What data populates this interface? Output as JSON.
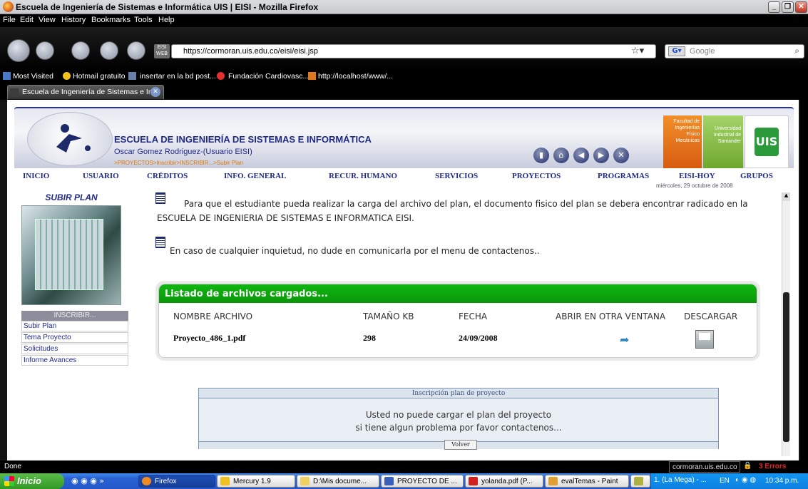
{
  "window": {
    "title": "Escuela de Ingeniería de Sistemas e Informática UIS | EISI - Mozilla Firefox"
  },
  "menubar": [
    "File",
    "Edit",
    "View",
    "History",
    "Bookmarks",
    "Tools",
    "Help"
  ],
  "navbar": {
    "url": "https://cormoran.uis.edu.co/eisi/eisi.jsp",
    "search_placeholder": "Google",
    "site_icon": "EISI WEB"
  },
  "bookmarks": [
    "Most Visited",
    "Hotmail gratuito",
    "insertar en la bd post...",
    "Fundación Cardiovasc...",
    "http://localhost/www/..."
  ],
  "tab": {
    "title": "Escuela de Ingeniería de Sistemas e In..."
  },
  "header": {
    "school": "ESCUELA DE INGENIERÍA DE SISTEMAS E INFORMÁTICA",
    "user": "Oscar Gomez Rodriguez-(Usuario EISI)",
    "breadcrumb": ">PROYECTOS>Inscribir>INSCRIBIR...>Subir Plan",
    "faculty": "Facultad de Ingenierías Físico Mecánicas",
    "university": "Universidad Industrial de Santander",
    "uis": "UIS"
  },
  "mainmenu": [
    "INICIO",
    "USUARIO",
    "CRÉDITOS",
    "INFO. GENERAL",
    "RECUR. HUMANO",
    "SERVICIOS",
    "PROYECTOS",
    "PROGRAMAS",
    "EISI-HOY",
    "GRUPOS"
  ],
  "date": "miércoles, 29 octubre de 2008",
  "sidebar": {
    "title": "SUBIR PLAN",
    "section": "INSCRIBIR...",
    "links": [
      "Subir Plan",
      "Tema Proyecto",
      "Solicitudes",
      "Informe Avances"
    ]
  },
  "content": {
    "para1": "Para que el estudiante pueda realizar la carga del archivo del plan, el documento fisico del plan se debera encontrar radicado en la ESCUELA DE INGENIERIA DE SISTEMAS E       INFORMATICA EISI.",
    "para2": "En caso de cualquier inquietud, no dude en comunicarla por el menu de contactenos..",
    "files": {
      "title": "Listado de archivos cargados...",
      "headers": [
        "NOMBRE ARCHIVO",
        "TAMAÑO KB",
        "FECHA",
        "ABRIR EN OTRA VENTANA",
        "DESCARGAR"
      ],
      "rows": [
        {
          "name": "Proyecto_486_1.pdf",
          "size": "298",
          "date": "24/09/2008"
        }
      ]
    },
    "inscripcion": {
      "title": "Inscripción plan de proyecto",
      "msg1": "Usted no puede cargar el plan del proyecto",
      "msg2": "si tiene algun problema por favor contactenos...",
      "button": "Volver"
    }
  },
  "status": {
    "left": "Done",
    "domain": "cormoran.uis.edu.co",
    "errors": "3 Errors"
  },
  "taskbar": {
    "start": "Inicio",
    "items": [
      "Firefox",
      "Mercury 1.9",
      "D:\\Mis docume...",
      "PROYECTO DE ...",
      "yolanda.pdf (P...",
      "evalTemas - Paint",
      "1. (La Mega) - ..."
    ],
    "lang": "EN",
    "clock": "10:34 p.m."
  }
}
